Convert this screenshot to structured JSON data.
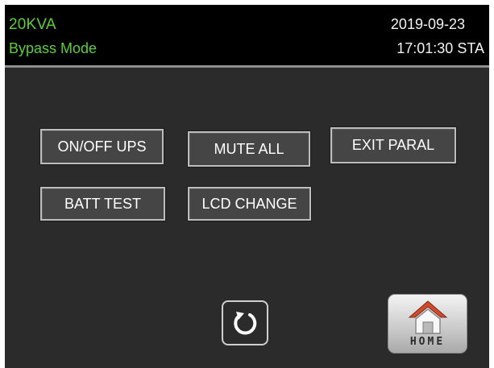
{
  "header": {
    "model": "20KVA",
    "mode": "Bypass Mode",
    "date": "2019-09-23",
    "time": "17:01:30 STA"
  },
  "controls": {
    "on_off_ups": "ON/OFF UPS",
    "mute_all": "MUTE ALL",
    "exit_paral": "EXIT PARAL",
    "batt_test": "BATT TEST",
    "lcd_change": "LCD CHANGE"
  },
  "footer": {
    "back_icon": "refresh-back-icon",
    "home_icon": "house-icon",
    "home_label": "HOME"
  },
  "colors": {
    "status_text": "#59d12e",
    "header_bg": "#000000",
    "screen_bg": "#2b2b2b",
    "button_bg": "#454545"
  }
}
